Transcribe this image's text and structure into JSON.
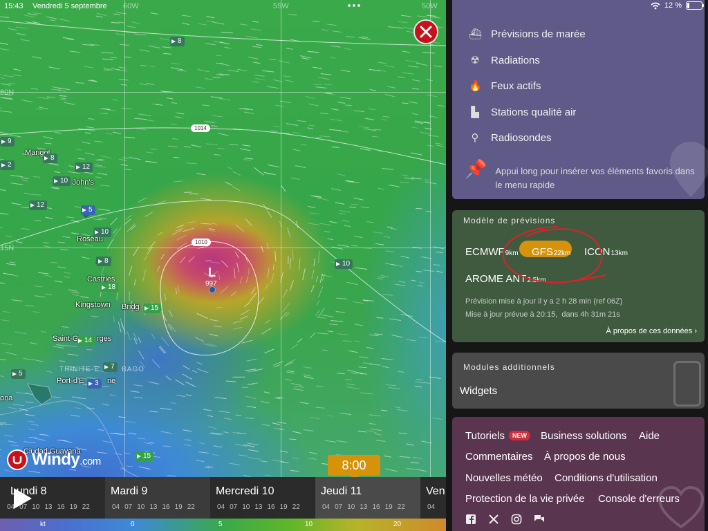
{
  "status_bar": {
    "time": "15:43",
    "date": "Vendredi 5 septembre",
    "battery": "12 %"
  },
  "map": {
    "grid_labels": {
      "lon_60": "60W",
      "lon_55": "55W",
      "lon_50": "50W",
      "lat_20": "20N",
      "lat_15": "15N"
    },
    "places": {
      "marigot": "Marigot",
      "st_johns": "St. John's",
      "roseau": "Roseau",
      "castries": "Castries",
      "kingstown": "Kingstown",
      "bridgetown": "Bridg",
      "st_georges": "Saint-G",
      "st_georges_end": "rges",
      "port_of_spain": "Port-d'E",
      "port_of_spain_end": "ne",
      "ciudad_guayana": "Ciudad Guayana",
      "trinidad": "TRINITE-E",
      "trinidad_end": "BAGO",
      "edge_label": "ona"
    },
    "stations": [
      "8",
      "9",
      "8",
      "12",
      "10",
      "2",
      "12",
      "5",
      "10",
      "8",
      "18",
      "15",
      "10",
      "14",
      "7",
      "5",
      "3",
      "15"
    ],
    "pressure_labels": {
      "isobar_1014": "1014",
      "isobar_1010": "1010"
    },
    "low": {
      "letter": "L",
      "value": "997"
    },
    "close_label": "close"
  },
  "logo": {
    "brand": "Windy",
    "suffix": ".com"
  },
  "timeline": {
    "current_time": "8:00",
    "days": [
      {
        "name": "Lundi 8",
        "hours": [
          "04",
          "07",
          "10",
          "13",
          "16",
          "19",
          "22"
        ]
      },
      {
        "name": "Mardi 9",
        "hours": [
          "04",
          "07",
          "10",
          "13",
          "16",
          "19",
          "22"
        ]
      },
      {
        "name": "Mercredi 10",
        "hours": [
          "04",
          "07",
          "10",
          "13",
          "16",
          "19",
          "22"
        ]
      },
      {
        "name": "Jeudi 11",
        "hours": [
          "04",
          "07",
          "10",
          "13",
          "16",
          "19",
          "22"
        ]
      },
      {
        "name": "Ven",
        "hours": [
          "04"
        ]
      }
    ]
  },
  "scale": {
    "unit": "kt",
    "ticks": [
      "0",
      "5",
      "10",
      "20"
    ]
  },
  "panel": {
    "layers": [
      {
        "icon": "ship-icon",
        "label": "Prévisions de marée"
      },
      {
        "icon": "radiation-icon",
        "label": "Radiations"
      },
      {
        "icon": "fire-icon",
        "label": "Feux actifs"
      },
      {
        "icon": "factory-icon",
        "label": "Stations qualité air"
      },
      {
        "icon": "balloon-icon",
        "label": "Radiosondes"
      }
    ],
    "pin_hint": "Appui long pour insérer vos éléments favoris dans le menu rapide",
    "model": {
      "title": "Modèle de prévisions",
      "options": [
        {
          "name": "ECMWF",
          "res": "9km"
        },
        {
          "name": "GFS",
          "res": "22km",
          "selected": true
        },
        {
          "name": "ICON",
          "res": "13km"
        },
        {
          "name": "AROME ANT",
          "res": "2.5km"
        }
      ],
      "updated": "Prévision mise à jour il y a 2 h 28 min (ref 06Z)",
      "next_update": "Mise à jour prévue à 20:15,  dans 4h 31m 21s",
      "about_link": "À propos de ces données"
    },
    "modules": {
      "title": "Modules additionnels",
      "widgets": "Widgets"
    },
    "links": {
      "tutorials": "Tutoriels",
      "new_badge": "NEW",
      "business": "Business solutions",
      "help": "Aide",
      "comments": "Commentaires",
      "about_us": "À propos de nous",
      "news": "Nouvelles météo",
      "terms": "Conditions d'utilisation",
      "privacy": "Protection de la vie privée",
      "console": "Console d'erreurs"
    },
    "social": [
      "facebook-icon",
      "x-icon",
      "instagram-icon",
      "chat-icon"
    ]
  },
  "colors": {
    "accent": "#d6930a",
    "close_red": "#c8111a",
    "layers_bg": "#5f5a87",
    "model_bg": "#3f5a3f",
    "links_bg": "#5a3550"
  }
}
